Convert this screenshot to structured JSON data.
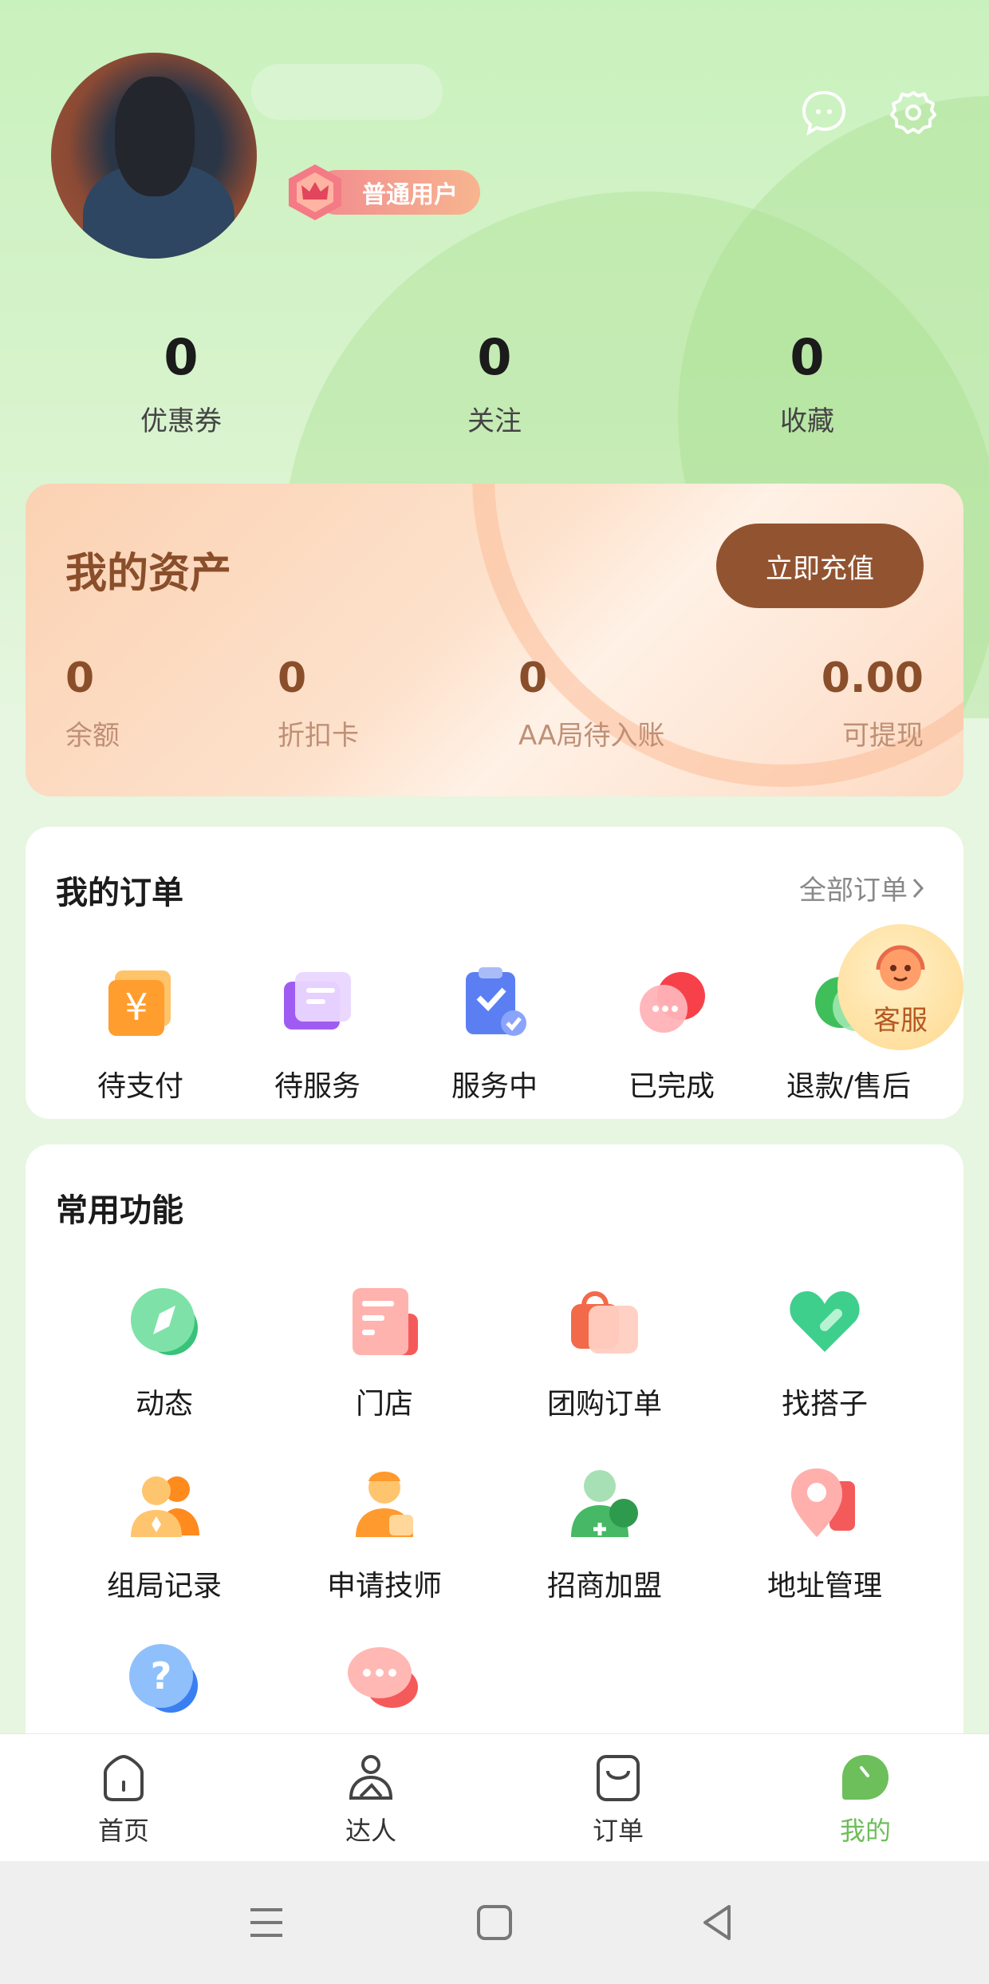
{
  "profile": {
    "badge": "普通用户"
  },
  "stats": [
    {
      "value": "0",
      "label": "优惠券"
    },
    {
      "value": "0",
      "label": "关注"
    },
    {
      "value": "0",
      "label": "收藏"
    }
  ],
  "assets": {
    "title": "我的资产",
    "recharge_label": "立即充值",
    "items": [
      {
        "value": "0",
        "label": "余额"
      },
      {
        "value": "0",
        "label": "折扣卡"
      },
      {
        "value": "0",
        "label": "AA局待入账"
      },
      {
        "value": "0.00",
        "label": "可提现"
      }
    ]
  },
  "orders": {
    "title": "我的订单",
    "all_label": "全部订单",
    "items": [
      {
        "label": "待支付",
        "icon": "yuan-wallet-icon"
      },
      {
        "label": "待服务",
        "icon": "card-icon"
      },
      {
        "label": "服务中",
        "icon": "clipboard-check-icon"
      },
      {
        "label": "已完成",
        "icon": "chat-bubble-icon"
      },
      {
        "label": "退款/售后",
        "icon": "refund-icon"
      }
    ]
  },
  "functions": {
    "title": "常用功能",
    "items": [
      {
        "label": "动态",
        "icon": "compass-icon"
      },
      {
        "label": "门店",
        "icon": "store-icon"
      },
      {
        "label": "团购订单",
        "icon": "shopping-bag-icon"
      },
      {
        "label": "找搭子",
        "icon": "heart-icon"
      },
      {
        "label": "组局记录",
        "icon": "group-icon"
      },
      {
        "label": "申请技师",
        "icon": "technician-icon"
      },
      {
        "label": "招商加盟",
        "icon": "add-user-icon"
      },
      {
        "label": "地址管理",
        "icon": "location-icon"
      },
      {
        "label": "",
        "icon": "help-icon"
      },
      {
        "label": "",
        "icon": "message-icon"
      }
    ]
  },
  "service": {
    "label": "客服"
  },
  "tabs": [
    {
      "label": "首页",
      "icon": "home-icon"
    },
    {
      "label": "达人",
      "icon": "talent-icon"
    },
    {
      "label": "订单",
      "icon": "bag-icon"
    },
    {
      "label": "我的",
      "icon": "mine-icon",
      "active": true
    }
  ],
  "colors": {
    "accent": "#6cbf5a",
    "asset_text": "#8a4e2b",
    "recharge_bg": "#925430"
  }
}
